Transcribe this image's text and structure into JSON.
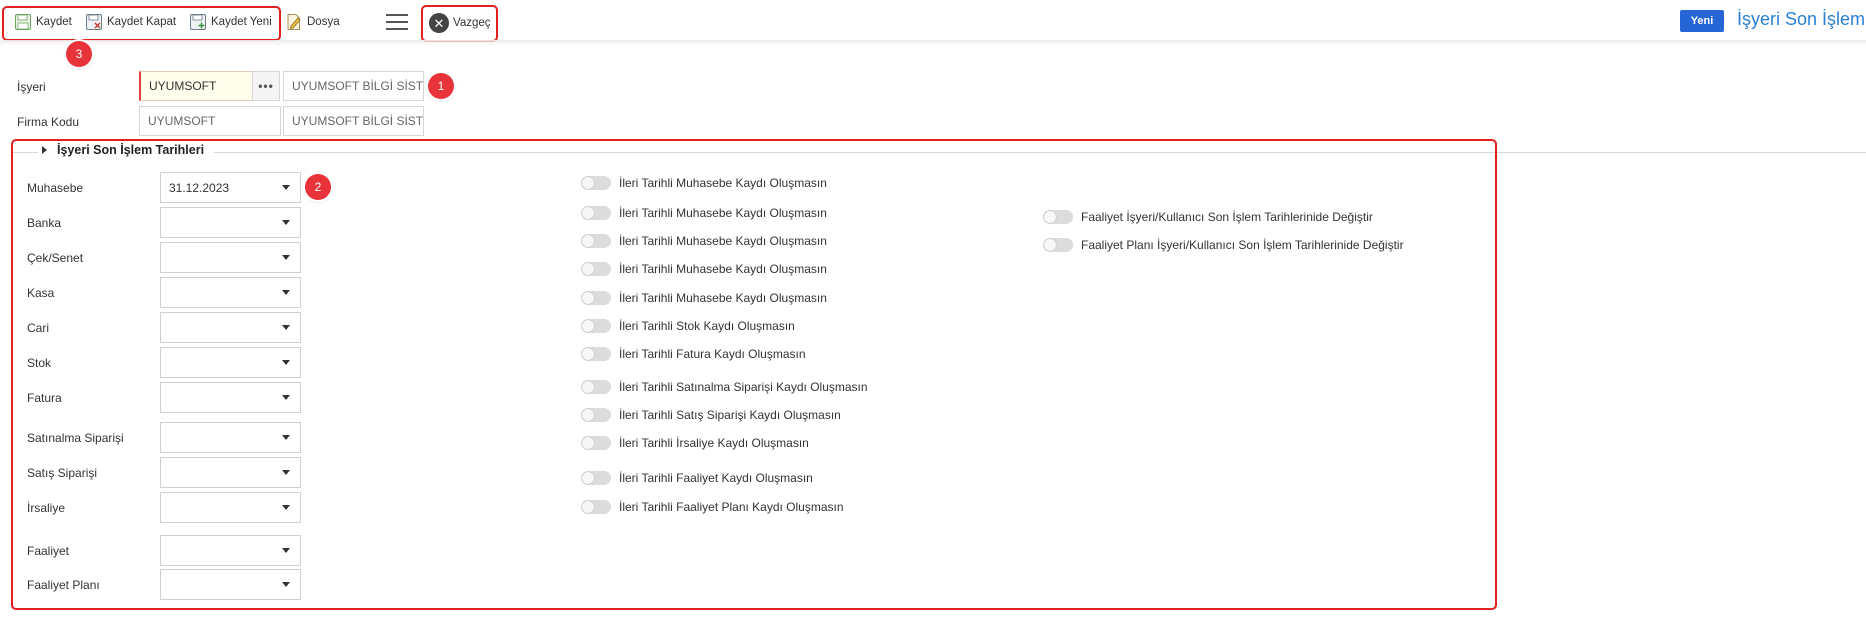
{
  "toolbar": {
    "save_label": "Kaydet",
    "save_close_label": "Kaydet Kapat",
    "save_new_label": "Kaydet Yeni",
    "file_label": "Dosya",
    "cancel_label": "Vazgeç"
  },
  "header": {
    "new_badge": "Yeni",
    "title": "İşyeri Son İşlem Tarihleri"
  },
  "markers": [
    "1",
    "2",
    "3"
  ],
  "form": {
    "isyeri": {
      "label": "İşyeri",
      "code": "UYUMSOFT",
      "dots": "•••",
      "name": "UYUMSOFT BİLGİ SİSTEMLERİ"
    },
    "firma": {
      "label": "Firma Kodu",
      "code": "UYUMSOFT",
      "name": "UYUMSOFT BİLGİ SİSTEMLERİ"
    }
  },
  "group": {
    "title": "İşyeri Son İşlem Tarihleri",
    "dates": [
      {
        "label": "Muhasebe",
        "value": "31.12.2023"
      },
      {
        "label": "Banka",
        "value": ""
      },
      {
        "label": "Çek/Senet",
        "value": ""
      },
      {
        "label": "Kasa",
        "value": ""
      },
      {
        "label": "Cari",
        "value": ""
      },
      {
        "label": "Stok",
        "value": ""
      },
      {
        "label": "Fatura",
        "value": ""
      },
      {
        "label": "Satınalma Siparişi",
        "value": ""
      },
      {
        "label": "Satış Siparişi",
        "value": ""
      },
      {
        "label": "İrsaliye",
        "value": ""
      },
      {
        "label": "Faaliyet",
        "value": ""
      },
      {
        "label": "Faaliyet Planı",
        "value": ""
      }
    ],
    "toggles": [
      {
        "label": "İleri Tarihli Muhasebe Kaydı Oluşmasın",
        "on": false
      },
      {
        "label": "İleri Tarihli Muhasebe Kaydı Oluşmasın",
        "on": false
      },
      {
        "label": "İleri Tarihli Muhasebe Kaydı Oluşmasın",
        "on": false
      },
      {
        "label": "İleri Tarihli Muhasebe Kaydı Oluşmasın",
        "on": false
      },
      {
        "label": "İleri Tarihli Muhasebe Kaydı Oluşmasın",
        "on": false
      },
      {
        "label": "İleri Tarihli Stok Kaydı Oluşmasın",
        "on": false
      },
      {
        "label": "İleri Tarihli Fatura Kaydı Oluşmasın",
        "on": false
      },
      {
        "label": "İleri Tarihli Satınalma Siparişi Kaydı Oluşmasın",
        "on": false
      },
      {
        "label": "İleri Tarihli Satış Siparişi Kaydı Oluşmasın",
        "on": false
      },
      {
        "label": "İleri Tarihli İrsaliye Kaydı Oluşmasın",
        "on": false
      },
      {
        "label": "İleri Tarihli Faaliyet Kaydı Oluşmasın",
        "on": false
      },
      {
        "label": "İleri Tarihli Faaliyet Planı Kaydı Oluşmasın",
        "on": false
      }
    ],
    "extra_toggles": [
      {
        "label": "Faaliyet İşyeri/Kullanıcı Son İşlem Tarihlerinide Değiştir",
        "on": false
      },
      {
        "label": "Faaliyet Planı İşyeri/Kullanıcı Son İşlem Tarihlerinide Değiştir",
        "on": false
      }
    ]
  },
  "colors": {
    "accent_blue": "#2565d6",
    "title_blue": "#2a7fd4",
    "highlight_red": "#e02020"
  }
}
